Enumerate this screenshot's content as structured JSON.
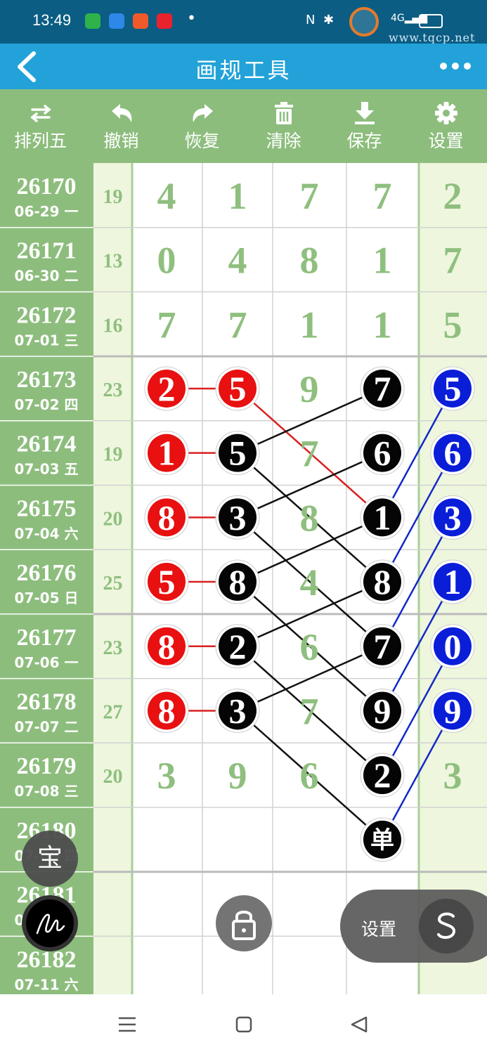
{
  "status_bar": {
    "time": "13:49",
    "watermark": "www.tqcp.net"
  },
  "header": {
    "back_icon": "chevron-left-icon",
    "title": "画规工具",
    "more_icon": "more-dots-icon"
  },
  "toolbar": [
    {
      "label": "排列五",
      "icon": "swap-icon"
    },
    {
      "label": "撤销",
      "icon": "undo-icon"
    },
    {
      "label": "恢复",
      "icon": "redo-icon"
    },
    {
      "label": "清除",
      "icon": "trash-icon"
    },
    {
      "label": "保存",
      "icon": "download-icon"
    },
    {
      "label": "设置",
      "icon": "gear-icon"
    }
  ],
  "rows": [
    {
      "issue": "26170",
      "date": "06-29 一",
      "sum": "19",
      "digits": [
        "4",
        "1",
        "7",
        "7",
        "2"
      ]
    },
    {
      "issue": "26171",
      "date": "06-30 二",
      "sum": "13",
      "digits": [
        "0",
        "4",
        "8",
        "1",
        "7"
      ]
    },
    {
      "issue": "26172",
      "date": "07-01 三",
      "sum": "16",
      "digits": [
        "7",
        "7",
        "1",
        "1",
        "5"
      ]
    },
    {
      "issue": "26173",
      "date": "07-02 四",
      "sum": "23",
      "digits": [
        "2",
        "5",
        "9",
        "7",
        "5"
      ]
    },
    {
      "issue": "26174",
      "date": "07-03 五",
      "sum": "19",
      "digits": [
        "1",
        "5",
        "7",
        "6",
        "6"
      ]
    },
    {
      "issue": "26175",
      "date": "07-04 六",
      "sum": "20",
      "digits": [
        "8",
        "3",
        "8",
        "1",
        "3"
      ]
    },
    {
      "issue": "26176",
      "date": "07-05 日",
      "sum": "25",
      "digits": [
        "5",
        "8",
        "4",
        "8",
        "1"
      ]
    },
    {
      "issue": "26177",
      "date": "07-06 一",
      "sum": "23",
      "digits": [
        "8",
        "2",
        "6",
        "7",
        "0"
      ]
    },
    {
      "issue": "26178",
      "date": "07-07 二",
      "sum": "27",
      "digits": [
        "8",
        "3",
        "7",
        "9",
        "9"
      ]
    },
    {
      "issue": "26179",
      "date": "07-08 三",
      "sum": "20",
      "digits": [
        "3",
        "9",
        "6",
        "2",
        "3"
      ]
    },
    {
      "issue": "26180",
      "date": "07-09 四",
      "sum": "",
      "digits": [
        "",
        "",
        "",
        "单",
        ""
      ]
    },
    {
      "issue": "26181",
      "date": "07-10 五",
      "sum": "",
      "digits": [
        "",
        "",
        "",
        "",
        ""
      ]
    },
    {
      "issue": "26182",
      "date": "07-11 六",
      "sum": "",
      "digits": [
        "",
        "",
        "",
        "",
        ""
      ]
    }
  ],
  "markers": [
    {
      "row": 3,
      "col": 0,
      "style": "red"
    },
    {
      "row": 3,
      "col": 1,
      "style": "red"
    },
    {
      "row": 4,
      "col": 0,
      "style": "red"
    },
    {
      "row": 5,
      "col": 0,
      "style": "red"
    },
    {
      "row": 6,
      "col": 0,
      "style": "red"
    },
    {
      "row": 7,
      "col": 0,
      "style": "red"
    },
    {
      "row": 8,
      "col": 0,
      "style": "red"
    },
    {
      "row": 4,
      "col": 1,
      "style": "black"
    },
    {
      "row": 5,
      "col": 1,
      "style": "black"
    },
    {
      "row": 6,
      "col": 1,
      "style": "black"
    },
    {
      "row": 7,
      "col": 1,
      "style": "black"
    },
    {
      "row": 8,
      "col": 1,
      "style": "black"
    },
    {
      "row": 3,
      "col": 3,
      "style": "black"
    },
    {
      "row": 4,
      "col": 3,
      "style": "black"
    },
    {
      "row": 5,
      "col": 3,
      "style": "black"
    },
    {
      "row": 6,
      "col": 3,
      "style": "black"
    },
    {
      "row": 7,
      "col": 3,
      "style": "black"
    },
    {
      "row": 8,
      "col": 3,
      "style": "black"
    },
    {
      "row": 9,
      "col": 3,
      "style": "black"
    },
    {
      "row": 10,
      "col": 3,
      "style": "black"
    },
    {
      "row": 3,
      "col": 4,
      "style": "blue"
    },
    {
      "row": 4,
      "col": 4,
      "style": "blue"
    },
    {
      "row": 5,
      "col": 4,
      "style": "blue"
    },
    {
      "row": 6,
      "col": 4,
      "style": "blue"
    },
    {
      "row": 7,
      "col": 4,
      "style": "blue"
    },
    {
      "row": 8,
      "col": 4,
      "style": "blue"
    }
  ],
  "links": [
    {
      "from": [
        3,
        0
      ],
      "to": [
        3,
        1
      ],
      "color": "red"
    },
    {
      "from": [
        4,
        0
      ],
      "to": [
        4,
        1
      ],
      "color": "red"
    },
    {
      "from": [
        5,
        0
      ],
      "to": [
        5,
        1
      ],
      "color": "red"
    },
    {
      "from": [
        6,
        0
      ],
      "to": [
        6,
        1
      ],
      "color": "red"
    },
    {
      "from": [
        7,
        0
      ],
      "to": [
        7,
        1
      ],
      "color": "red"
    },
    {
      "from": [
        8,
        0
      ],
      "to": [
        8,
        1
      ],
      "color": "red"
    },
    {
      "from": [
        3,
        1
      ],
      "to": [
        5,
        3
      ],
      "color": "red"
    },
    {
      "from": [
        4,
        1
      ],
      "to": [
        3,
        3
      ],
      "color": "black"
    },
    {
      "from": [
        5,
        1
      ],
      "to": [
        4,
        3
      ],
      "color": "black"
    },
    {
      "from": [
        6,
        1
      ],
      "to": [
        5,
        3
      ],
      "color": "black"
    },
    {
      "from": [
        7,
        1
      ],
      "to": [
        6,
        3
      ],
      "color": "black"
    },
    {
      "from": [
        8,
        1
      ],
      "to": [
        7,
        3
      ],
      "color": "black"
    },
    {
      "from": [
        4,
        1
      ],
      "to": [
        6,
        3
      ],
      "color": "black"
    },
    {
      "from": [
        5,
        1
      ],
      "to": [
        7,
        3
      ],
      "color": "black"
    },
    {
      "from": [
        6,
        1
      ],
      "to": [
        8,
        3
      ],
      "color": "black"
    },
    {
      "from": [
        7,
        1
      ],
      "to": [
        9,
        3
      ],
      "color": "black"
    },
    {
      "from": [
        8,
        1
      ],
      "to": [
        10,
        3
      ],
      "color": "black"
    },
    {
      "from": [
        5,
        3
      ],
      "to": [
        3,
        4
      ],
      "color": "blue"
    },
    {
      "from": [
        6,
        3
      ],
      "to": [
        4,
        4
      ],
      "color": "blue"
    },
    {
      "from": [
        7,
        3
      ],
      "to": [
        5,
        4
      ],
      "color": "blue"
    },
    {
      "from": [
        8,
        3
      ],
      "to": [
        6,
        4
      ],
      "color": "blue"
    },
    {
      "from": [
        9,
        3
      ],
      "to": [
        7,
        4
      ],
      "color": "blue"
    },
    {
      "from": [
        10,
        3
      ],
      "to": [
        8,
        4
      ],
      "color": "blue"
    }
  ],
  "colors": {
    "grid_line": "#d2d2d2",
    "issue_col_bg": "#8dbd7d",
    "sum_col_bg": "#eef6dd",
    "digit_color": "#8fbf7e",
    "marker_red": "#e81010",
    "marker_black": "#050505",
    "marker_blue": "#0a1ed8",
    "link_red": "#d92020",
    "link_black": "#111111",
    "link_blue": "#1428c8"
  },
  "floating": {
    "bao_label": "宝",
    "sign_icon": "signature-icon",
    "lock_icon": "lock-icon",
    "settings_label": "设置",
    "s_icon": "s-switch-icon"
  },
  "nav": {
    "menu_icon": "menu-icon",
    "home_icon": "home-square-icon",
    "back_icon": "back-triangle-icon"
  }
}
